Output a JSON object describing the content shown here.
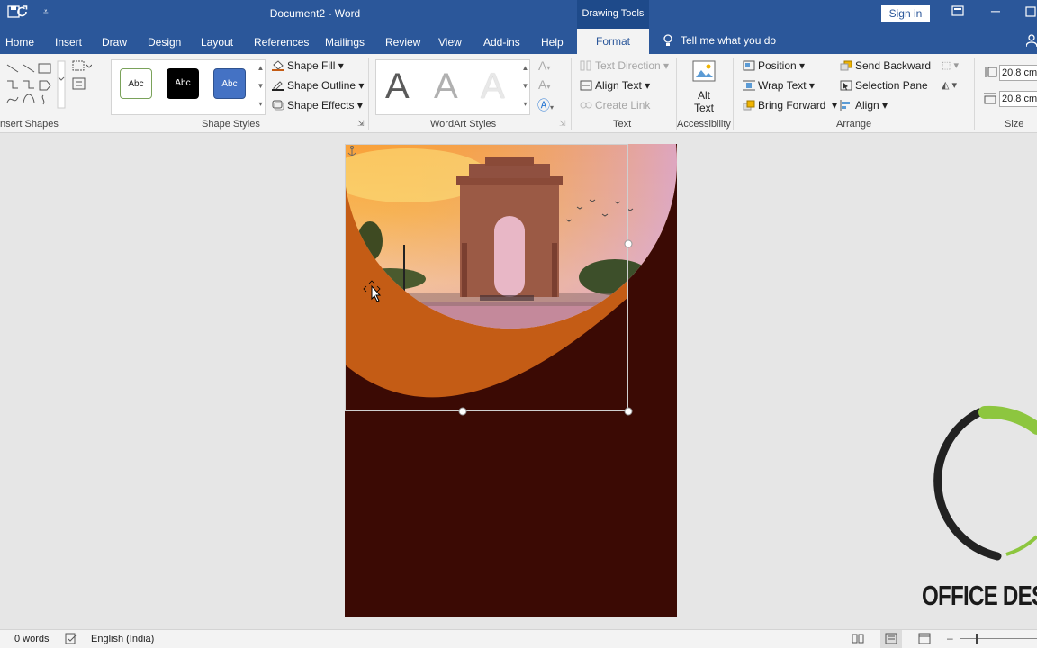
{
  "window": {
    "doc_title": "Document2  -  Word",
    "contextual_label": "Drawing Tools",
    "sign_in": "Sign in"
  },
  "menu": {
    "items": [
      "Home",
      "Insert",
      "Draw",
      "Design",
      "Layout",
      "References",
      "Mailings",
      "Review",
      "View",
      "Add-ins",
      "Help"
    ],
    "active_tab": "Format",
    "tell_me": "Tell me what you do"
  },
  "ribbon": {
    "insert_shapes": {
      "label": "nsert Shapes"
    },
    "shape_styles": {
      "label": "Shape Styles",
      "swatch_text": "Abc",
      "shape_fill": "Shape Fill",
      "shape_outline": "Shape Outline",
      "shape_effects": "Shape Effects"
    },
    "wordart_styles": {
      "label": "WordArt Styles",
      "letter": "A"
    },
    "text": {
      "label": "Text",
      "text_direction": "Text Direction",
      "align_text": "Align Text",
      "create_link": "Create Link"
    },
    "accessibility": {
      "label": "Accessibility",
      "alt_text_line1": "Alt",
      "alt_text_line2": "Text"
    },
    "arrange": {
      "label": "Arrange",
      "position": "Position",
      "wrap_text": "Wrap Text",
      "bring_forward": "Bring Forward",
      "send_backward": "Send Backward",
      "selection_pane": "Selection Pane",
      "align": "Align"
    },
    "size": {
      "label": "Size",
      "height": "20.8 cm",
      "width": "20.8 cm"
    }
  },
  "status": {
    "words": "0 words",
    "language": "English (India)"
  },
  "watermark": {
    "text": "OFFICE DES"
  },
  "colors": {
    "word_blue": "#2b579a",
    "page_bg": "#3b0a04",
    "orange_shape": "#c45c15",
    "logo_green": "#8dc63f"
  }
}
